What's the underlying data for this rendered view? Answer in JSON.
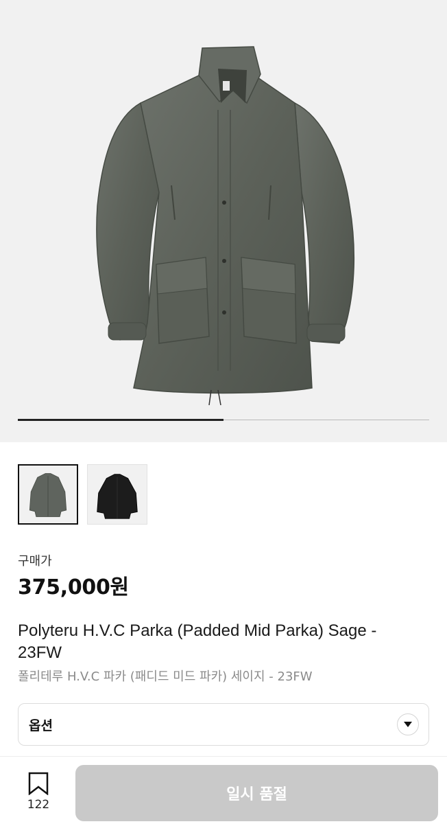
{
  "gallery": {
    "progress": 0.5,
    "thumbnails": [
      {
        "icon": "sage-parka-thumbnail",
        "color": "#5f645e",
        "selected": true
      },
      {
        "icon": "black-parka-thumbnail",
        "color": "#1c1c1c",
        "selected": false
      }
    ]
  },
  "price": {
    "label": "구매가",
    "value": "375,000원"
  },
  "product": {
    "title": "Polyteru H.V.C Parka (Padded Mid Parka) Sage - 23FW",
    "subtitle": "폴리테루 H.V.C 파카 (패디드 미드 파카) 세이지 - 23FW"
  },
  "options": {
    "label": "옵션",
    "icon": "chevron-down-icon"
  },
  "bottom_bar": {
    "bookmark_icon": "bookmark-icon",
    "bookmark_count": "122",
    "action_label": "일시 품절"
  },
  "colors": {
    "hero_bg": "#f1f1f1",
    "button_disabled": "#c9c9c9",
    "parka_sage": "#5f645e"
  }
}
